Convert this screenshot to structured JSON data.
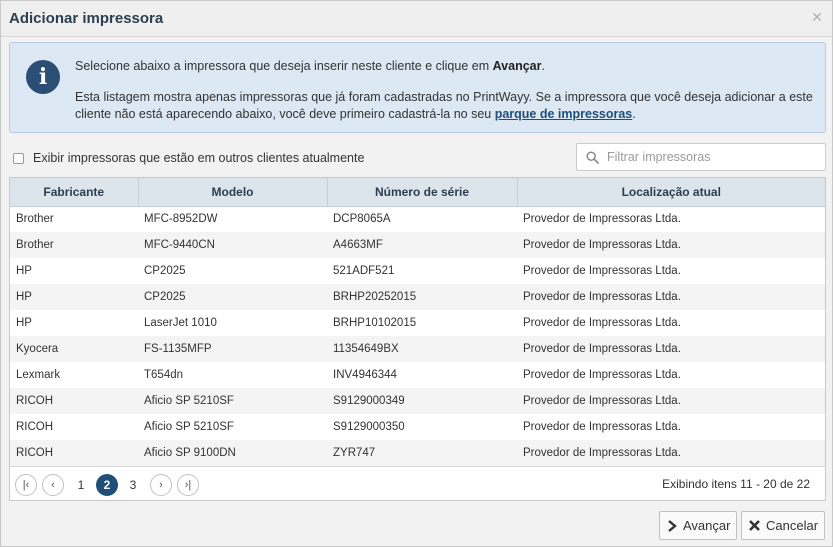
{
  "dialog": {
    "title": "Adicionar impressora",
    "close_icon": "close-icon"
  },
  "info": {
    "icon": "info-icon",
    "line1_prefix": "Selecione abaixo a impressora que deseja inserir neste cliente e clique em ",
    "line1_bold": "Avançar",
    "line1_suffix": ".",
    "line2_text": "Esta listagem mostra apenas impressoras que já foram cadastradas no PrintWayy. Se a impressora que você deseja adicionar a este cliente não está aparecendo abaixo, você deve primeiro cadastrá-la no seu ",
    "line2_link": "parque de impressoras",
    "line2_suffix": "."
  },
  "options": {
    "show_other_clients_label": "Exibir impressoras que estão em outros clientes atualmente",
    "show_other_clients_checked": false
  },
  "filter": {
    "placeholder": "Filtrar impressoras",
    "value": ""
  },
  "table": {
    "columns": [
      "Fabricante",
      "Modelo",
      "Número de série",
      "Localização atual"
    ],
    "rows": [
      [
        "Brother",
        "MFC-8952DW",
        "DCP8065A",
        "Provedor de Impressoras Ltda."
      ],
      [
        "Brother",
        "MFC-9440CN",
        "A4663MF",
        "Provedor de Impressoras Ltda."
      ],
      [
        "HP",
        "CP2025",
        "521ADF521",
        "Provedor de Impressoras Ltda."
      ],
      [
        "HP",
        "CP2025",
        "BRHP20252015",
        "Provedor de Impressoras Ltda."
      ],
      [
        "HP",
        "LaserJet 1010",
        "BRHP10102015",
        "Provedor de Impressoras Ltda."
      ],
      [
        "Kyocera",
        "FS-1135MFP",
        "11354649BX",
        "Provedor de Impressoras Ltda."
      ],
      [
        "Lexmark",
        "T654dn",
        "INV4946344",
        "Provedor de Impressoras Ltda."
      ],
      [
        "RICOH",
        "Aficio SP 5210SF",
        "S9129000349",
        "Provedor de Impressoras Ltda."
      ],
      [
        "RICOH",
        "Aficio SP 5210SF",
        "S9129000350",
        "Provedor de Impressoras Ltda."
      ],
      [
        "RICOH",
        "Aficio SP 9100DN",
        "ZYR747",
        "Provedor de Impressoras Ltda."
      ]
    ]
  },
  "pager": {
    "first_icon": "first-page-icon",
    "prev_icon": "prev-page-icon",
    "next_icon": "next-page-icon",
    "last_icon": "last-page-icon",
    "pages": [
      "1",
      "2",
      "3"
    ],
    "current_page": "2",
    "info": "Exibindo itens 11 - 20 de 22"
  },
  "buttons": {
    "next_label": "Avançar",
    "cancel_label": "Cancelar"
  },
  "colors": {
    "accent": "#1f4e79",
    "info_bg": "#dce8f3",
    "header_bg": "#dce4ec",
    "cancel_icon": "#333333"
  }
}
